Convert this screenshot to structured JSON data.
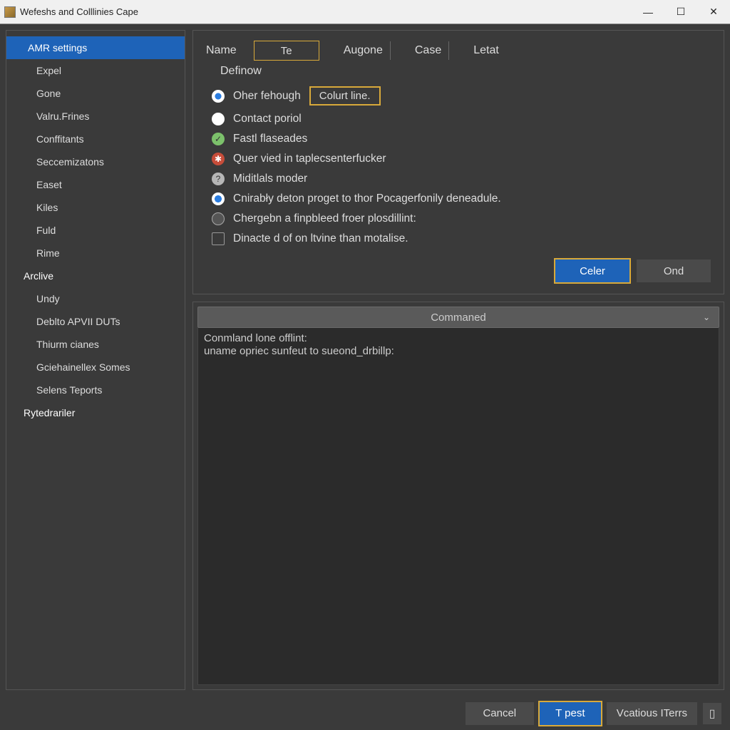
{
  "window": {
    "title": "Wefeshs and Colllinies Cape"
  },
  "sidebar": {
    "items": [
      {
        "label": "AMR settings",
        "selected": true,
        "level": "top"
      },
      {
        "label": "Expel",
        "level": "child"
      },
      {
        "label": "Gone",
        "level": "child"
      },
      {
        "label": "Valru.Frines",
        "level": "child"
      },
      {
        "label": "Conffitants",
        "level": "child"
      },
      {
        "label": "Seccemizatons",
        "level": "child"
      },
      {
        "label": "Easet",
        "level": "child"
      },
      {
        "label": "Kiles",
        "level": "child"
      },
      {
        "label": "Fuld",
        "level": "child"
      },
      {
        "label": "Rime",
        "level": "child"
      },
      {
        "label": "Arclive",
        "level": "top"
      },
      {
        "label": "Undy",
        "level": "child"
      },
      {
        "label": "Deblto APVII DUTs",
        "level": "child"
      },
      {
        "label": "Thiurm cianes",
        "level": "child"
      },
      {
        "label": "Gciehainellex Somes",
        "level": "child"
      },
      {
        "label": "Selens Teports",
        "level": "child"
      },
      {
        "label": "Rytedrariler",
        "level": "top"
      }
    ]
  },
  "header": {
    "name_label": "Name",
    "input_value": "Te",
    "tabs": [
      "Augone",
      "Case",
      "Letat"
    ]
  },
  "subheader": "Definow",
  "options": [
    {
      "icon": "radio-selected",
      "label": "Oher fehough",
      "extra": "Colurt line."
    },
    {
      "icon": "radio-empty",
      "label": "Contact poriol"
    },
    {
      "icon": "green-check",
      "label": "Fastl flaseades"
    },
    {
      "icon": "red-star",
      "label": "Quer vied in taplecsenterfucker"
    },
    {
      "icon": "grey-question",
      "label": "Miditlals moder"
    },
    {
      "icon": "blue-dot",
      "label": "Cnirabły deton proget to thor Pocagerfonily deneadule."
    },
    {
      "icon": "dark-circle",
      "label": "Chergebn a finpbleed froer plosdillint:"
    },
    {
      "icon": "checkbox",
      "label": "Dinacte d of on ltvine than motalise."
    }
  ],
  "panel_buttons": {
    "primary": "Celer",
    "secondary": "Ond"
  },
  "command": {
    "header": "Commaned",
    "line1": "Conmland lone offlint:",
    "line2": "uname opriec sunfeut to sueond_drbillp:"
  },
  "footer": {
    "cancel": "Cancel",
    "apply": "T pest",
    "other": "Vcatious ITerrs"
  }
}
